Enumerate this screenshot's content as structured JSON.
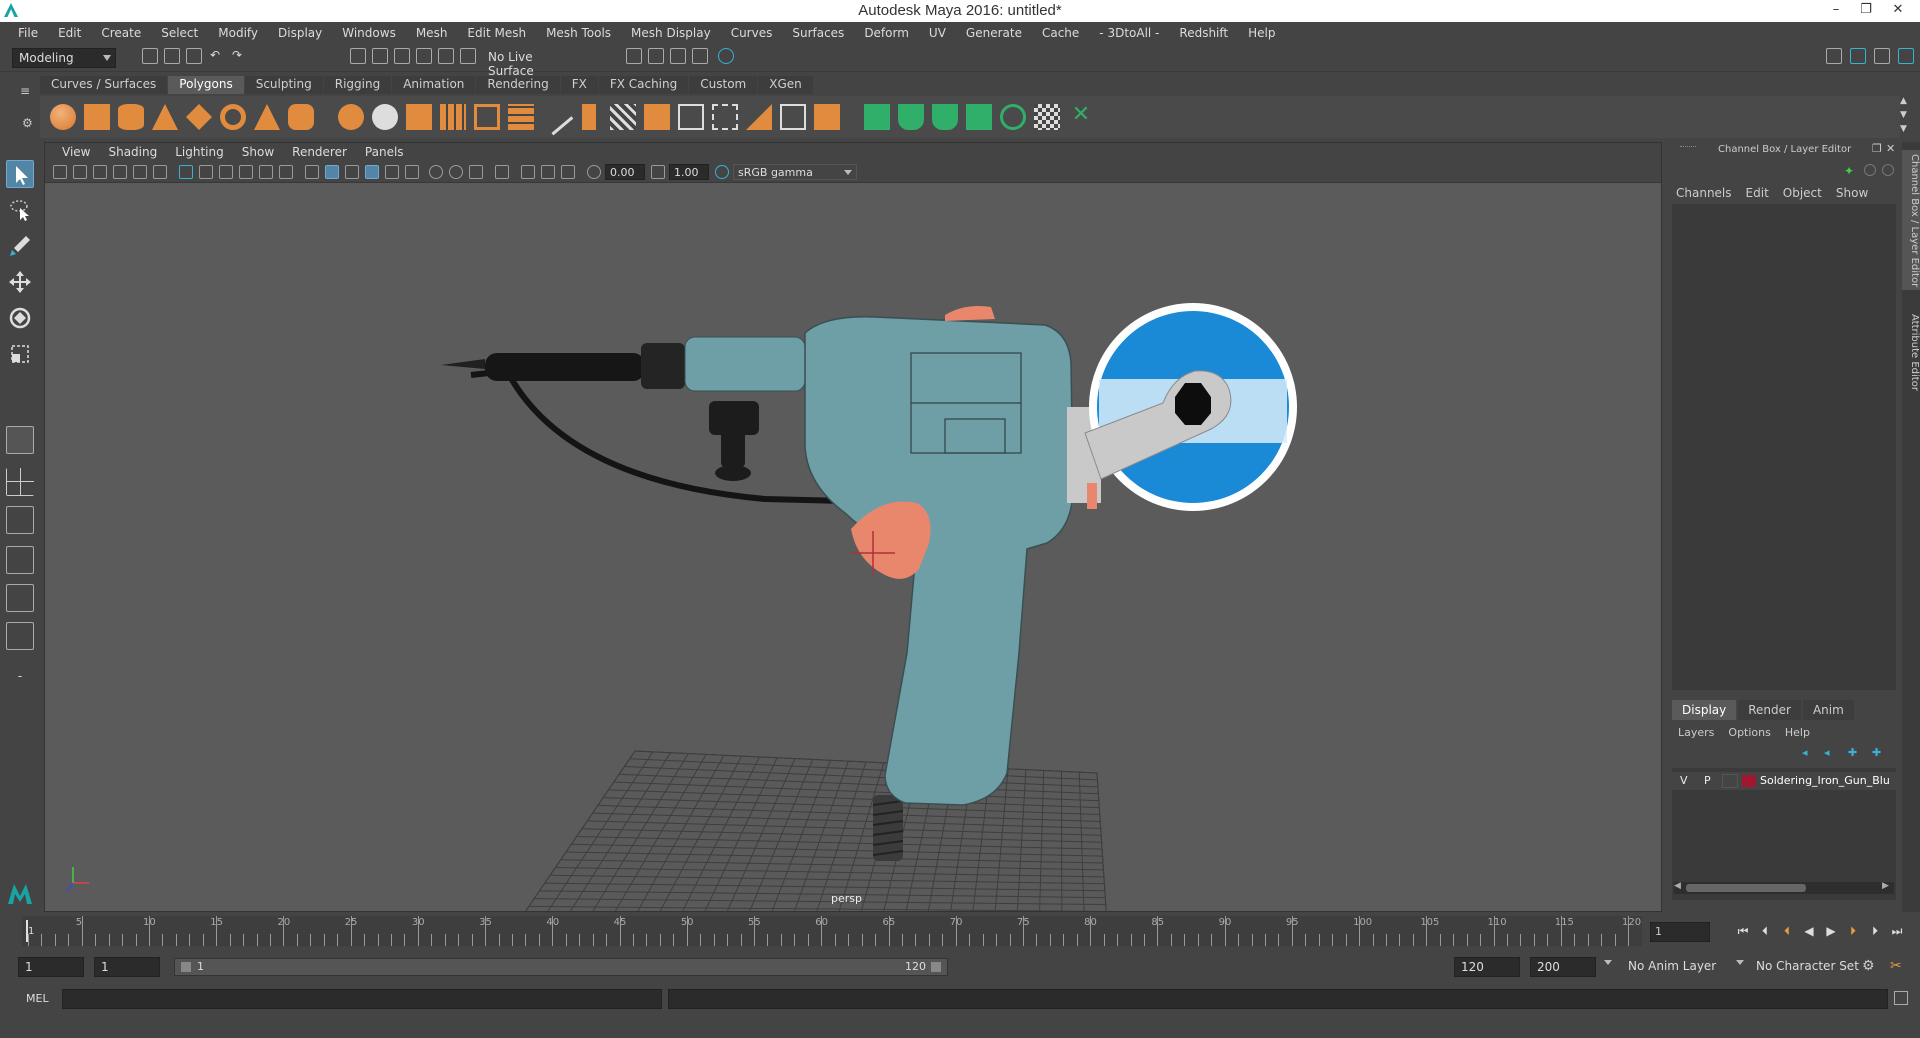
{
  "window": {
    "title": "Autodesk Maya 2016: untitled*"
  },
  "menu": [
    "File",
    "Edit",
    "Create",
    "Select",
    "Modify",
    "Display",
    "Windows",
    "Mesh",
    "Edit Mesh",
    "Mesh Tools",
    "Mesh Display",
    "Curves",
    "Surfaces",
    "Deform",
    "UV",
    "Generate",
    "Cache",
    "- 3DtoAll -",
    "Redshift",
    "Help"
  ],
  "status": {
    "mode": "Modeling",
    "live_surface": "No Live Surface"
  },
  "shelf": {
    "tabs": [
      "Curves / Surfaces",
      "Polygons",
      "Sculpting",
      "Rigging",
      "Animation",
      "Rendering",
      "FX",
      "FX Caching",
      "Custom",
      "XGen"
    ],
    "active": "Polygons"
  },
  "viewport": {
    "menu": [
      "View",
      "Shading",
      "Lighting",
      "Show",
      "Renderer",
      "Panels"
    ],
    "exposure": "0.00",
    "gamma": "1.00",
    "color_space": "sRGB gamma",
    "camera": "persp"
  },
  "channel_box": {
    "title": "Channel Box / Layer Editor",
    "menu": [
      "Channels",
      "Edit",
      "Object",
      "Show"
    ]
  },
  "layer_editor": {
    "tabs": [
      "Display",
      "Render",
      "Anim"
    ],
    "active": "Display",
    "menu": [
      "Layers",
      "Options",
      "Help"
    ],
    "layers": [
      {
        "v": "V",
        "p": "P",
        "name": "Soldering_Iron_Gun_Blu",
        "color": "#a0172f"
      }
    ]
  },
  "side_tabs": [
    "Channel Box / Layer Editor",
    "Attribute Editor"
  ],
  "time_slider": {
    "ticks": [
      "5",
      "10",
      "15",
      "20",
      "25",
      "30",
      "35",
      "40",
      "45",
      "50",
      "55",
      "60",
      "65",
      "70",
      "75",
      "80",
      "85",
      "90",
      "95",
      "100",
      "105",
      "110",
      "115",
      "120"
    ],
    "start_marker": "1",
    "current_frame": "1"
  },
  "range_slider": {
    "start": "1",
    "playback_start": "1",
    "range_left": "1",
    "range_right": "120",
    "playback_end": "120",
    "end": "200",
    "anim_layer": "No Anim Layer",
    "character_set": "No Character Set"
  },
  "command_line": {
    "label": "MEL"
  },
  "colors": {
    "gun_body": "#6e9ea6",
    "trigger": "#e8876c",
    "tape_blue": "#1a8ad6",
    "accent_teal": "#1aa3a3"
  }
}
